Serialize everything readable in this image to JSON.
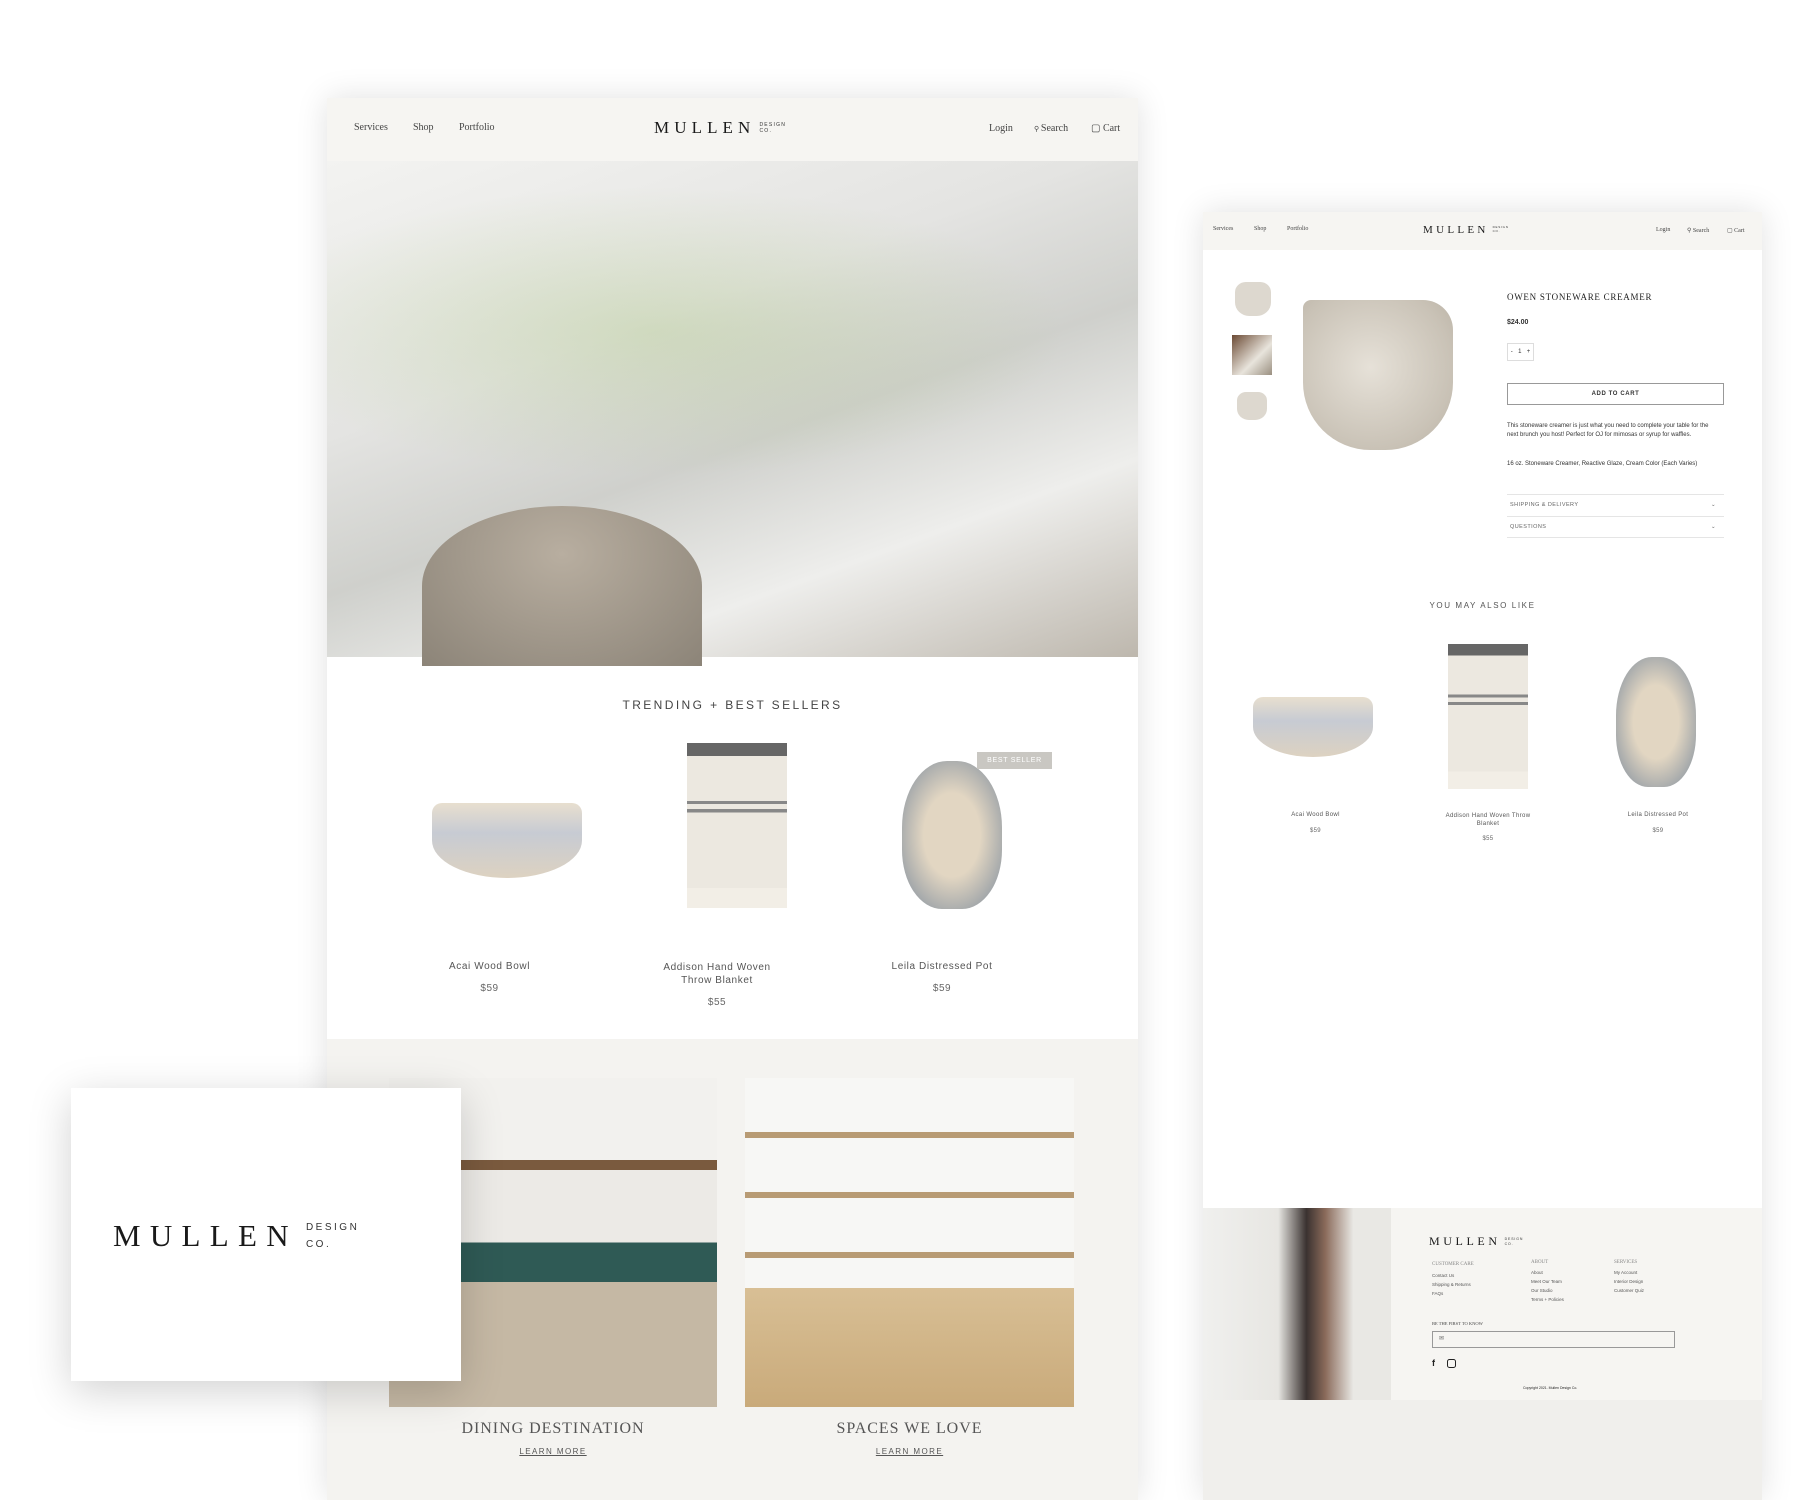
{
  "brand": {
    "name": "MULLEN",
    "sub1": "DESIGN",
    "sub2": "CO."
  },
  "main_page": {
    "nav": {
      "left": [
        "Services",
        "Shop",
        "Portfolio"
      ],
      "login": "Login",
      "search": "Search",
      "cart": "Cart"
    },
    "trending_title": "TRENDING + BEST SELLERS",
    "products": [
      {
        "name": "Acai Wood Bowl",
        "price": "$59"
      },
      {
        "name": "Addison Hand Woven Throw Blanket",
        "price": "$55"
      },
      {
        "name": "Leila Distressed Pot",
        "price": "$59",
        "badge": "BEST SELLER"
      }
    ],
    "features": [
      {
        "title": "DINING DESTINATION",
        "link": "LEARN MORE"
      },
      {
        "title": "SPACES WE LOVE",
        "link": "LEARN MORE"
      }
    ]
  },
  "product_page": {
    "nav": {
      "left": [
        "Services",
        "Shop",
        "Portfolio"
      ],
      "login": "Login",
      "search": "Search",
      "cart": "Cart"
    },
    "title": "OWEN STONEWARE CREAMER",
    "price": "$24.00",
    "qty": {
      "minus": "-",
      "value": "1",
      "plus": "+"
    },
    "add_to_cart": "ADD TO CART",
    "description": "This stoneware creamer is just what you need to complete your table for the next brunch you host! Perfect for OJ for mimosas or syrup for waffles.",
    "specs": "16 oz. Stoneware Creamer, Reactive Glaze, Cream Color (Each Varies)",
    "accordions": [
      "SHIPPING & DELIVERY",
      "QUESTIONS"
    ],
    "related_title": "YOU MAY ALSO LIKE",
    "related": [
      {
        "name": "Acai Wood Bowl",
        "price": "$59"
      },
      {
        "name": "Addison Hand Woven Throw Blanket",
        "price": "$55"
      },
      {
        "name": "Leila Distressed Pot",
        "price": "$59"
      }
    ],
    "footer": {
      "columns": [
        {
          "title": "CUSTOMER CARE",
          "links": [
            "Contact Us",
            "Shipping & Returns",
            "FAQs"
          ]
        },
        {
          "title": "ABOUT",
          "links": [
            "About",
            "Meet Our Team",
            "Our Studio",
            "Terms + Policies"
          ]
        },
        {
          "title": "SERVICES",
          "links": [
            "My Account",
            "Interior Design",
            "Customer Quiz"
          ]
        }
      ],
      "newsletter": "BE THE FIRST TO KNOW",
      "copyright": "Copyright 2021. Mullen Design Co."
    }
  },
  "colors": {
    "nav_bg": "#f6f5f2",
    "section_bg": "#f4f3f0",
    "text": "#333333",
    "badge": "#c9c7c2"
  }
}
